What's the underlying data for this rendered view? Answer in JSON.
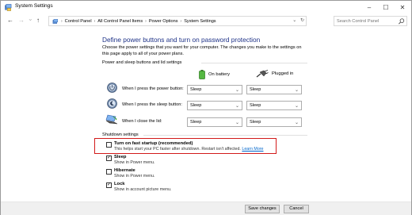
{
  "window": {
    "title": "System Settings",
    "minimize": "–",
    "maximize": "☐",
    "close": "✕"
  },
  "nav": {
    "back": "←",
    "forward": "→",
    "recent": "⌄",
    "up": "↑"
  },
  "address": {
    "crumbs": [
      "Control Panel",
      "All Control Panel Items",
      "Power Options",
      "System Settings"
    ],
    "dropdown": "⌄",
    "refresh": "↻"
  },
  "search": {
    "placeholder": "Search Control Panel"
  },
  "page": {
    "heading": "Define power buttons and turn on password protection",
    "description": "Choose the power settings that you want for your computer. The changes you make to the settings on this page apply to all of your power plans."
  },
  "power_section": {
    "label": "Power and sleep buttons and lid settings",
    "on_battery": "On battery",
    "plugged_in": "Plugged in",
    "rows": [
      {
        "label": "When I press the power button:",
        "battery": "Sleep",
        "plugged": "Sleep"
      },
      {
        "label": "When I press the sleep button:",
        "battery": "Sleep",
        "plugged": "Sleep"
      },
      {
        "label": "When I close the lid:",
        "battery": "Sleep",
        "plugged": "Sleep"
      }
    ]
  },
  "shutdown_section": {
    "label": "Shutdown settings",
    "items": [
      {
        "title": "Turn on fast startup (recommended)",
        "sub": "This helps start your PC faster after shutdown. Restart isn't affected.",
        "link": "Learn More",
        "checked": false
      },
      {
        "title": "Sleep",
        "sub": "Show in Power menu.",
        "checked": true
      },
      {
        "title": "Hibernate",
        "sub": "Show in Power menu.",
        "checked": false
      },
      {
        "title": "Lock",
        "sub": "Show in account picture menu.",
        "checked": true
      }
    ]
  },
  "footer": {
    "save": "Save changes",
    "cancel": "Cancel"
  },
  "colors": {
    "heading": "#1e3287",
    "highlight": "#d21a1a",
    "link": "#0066cc"
  }
}
